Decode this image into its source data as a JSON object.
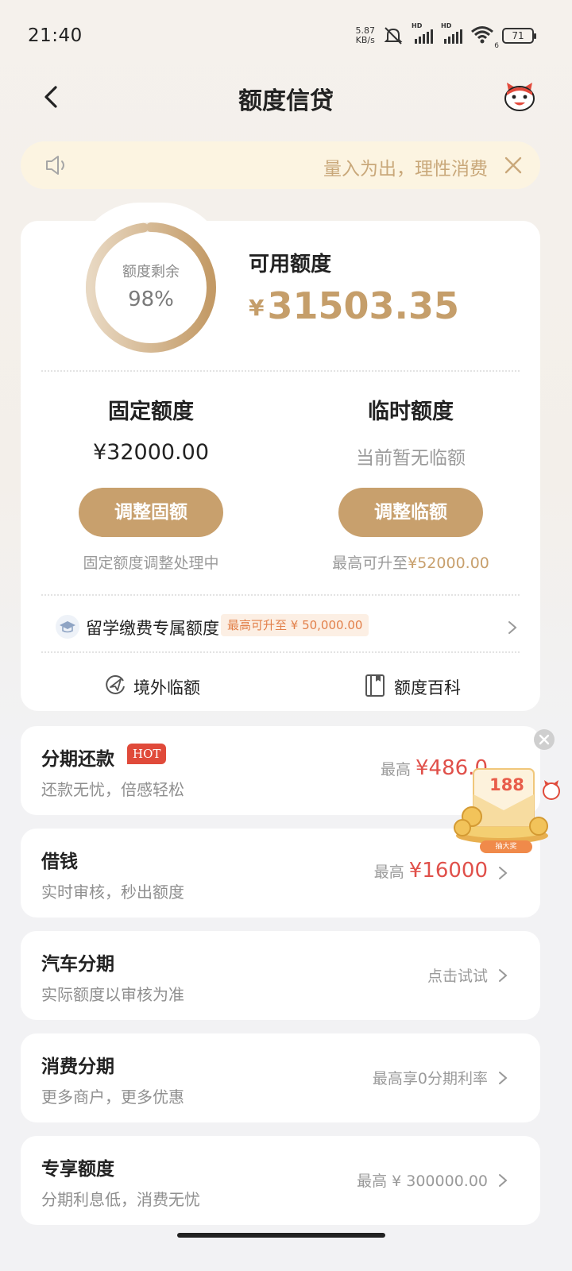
{
  "status_bar": {
    "time": "21:40",
    "net_speed_value": "5.87",
    "net_speed_unit": "KB/s",
    "hd_label": "HD",
    "wifi_sub": "6",
    "battery": "71"
  },
  "header": {
    "title": "额度信贷",
    "back_icon": "chevron-left-icon",
    "mascot_icon": "mascot-avatar-icon"
  },
  "notice": {
    "text": "量入为出，理性消费",
    "icon": "speaker-icon",
    "close_icon": "close-icon"
  },
  "credit": {
    "ring_label": "额度剩余",
    "ring_percent_text": "98%",
    "ring_fraction": 0.98,
    "available_title": "可用额度",
    "currency": "¥",
    "available_amount": "31503.35",
    "fixed": {
      "title": "固定额度",
      "amount": "¥32000.00",
      "button": "调整固额",
      "note": "固定额度调整处理中"
    },
    "temp": {
      "title": "临时额度",
      "amount": "当前暂无临额",
      "button": "调整临额",
      "note_prefix": "最高可升至",
      "note_amount": "¥52000.00"
    },
    "study": {
      "label": "留学缴费专属额度",
      "badge": "最高可升至 ¥ 50,000.00"
    },
    "links": [
      {
        "label": "境外临额",
        "icon": "overseas-plane-icon"
      },
      {
        "label": "额度百科",
        "icon": "book-icon"
      }
    ]
  },
  "list": [
    {
      "title": "分期还款",
      "badge": "HOT",
      "subtitle": "还款无忧，倍感轻松",
      "prefix": "最高",
      "amount": "¥486.0"
    },
    {
      "title": "借钱",
      "subtitle": "实时审核，秒出额度",
      "prefix": "最高",
      "amount": "¥16000"
    },
    {
      "title": "汽车分期",
      "subtitle": "实际额度以审核为准",
      "prefix": "点击试试"
    },
    {
      "title": "消费分期",
      "subtitle": "更多商户，更多优惠",
      "prefix": "最高享0分期利率"
    },
    {
      "title": "专享额度",
      "subtitle": "分期利息低，消费无忧",
      "prefix": "最高 ¥ 300000.00"
    }
  ],
  "promo": {
    "number": "188",
    "button": "抽大奖",
    "close_icon": "close-icon"
  },
  "colors": {
    "gold": "#c8a06d",
    "red": "#e0504a",
    "notice_bg": "#fcf4e1"
  }
}
